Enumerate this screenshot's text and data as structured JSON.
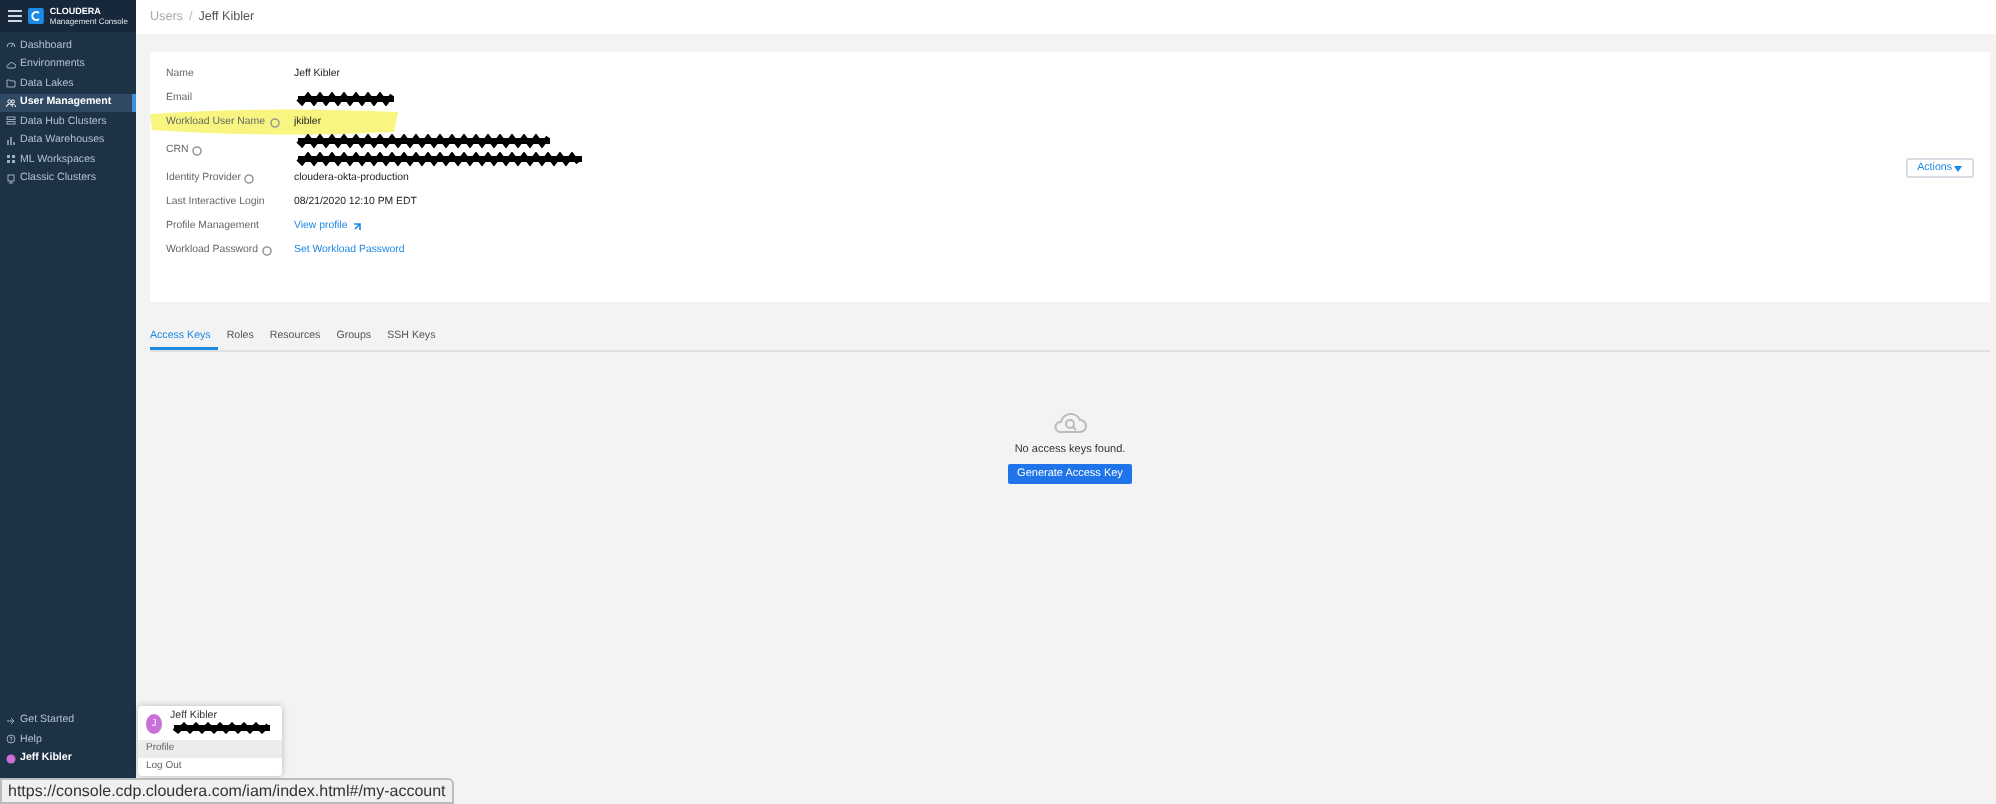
{
  "sidebar": {
    "brand": {
      "name": "CLOUDERA",
      "product": "Management Console"
    },
    "items": [
      {
        "label": "Dashboard",
        "selected": false
      },
      {
        "label": "Environments",
        "selected": false
      },
      {
        "label": "Data Lakes",
        "selected": false
      },
      {
        "label": "User Management",
        "selected": true
      },
      {
        "label": "Data Hub Clusters",
        "selected": false
      },
      {
        "label": "Data Warehouses",
        "selected": false
      },
      {
        "label": "ML Workspaces",
        "selected": false
      },
      {
        "label": "Classic Clusters",
        "selected": false
      }
    ],
    "footer": [
      {
        "label": "Get Started"
      },
      {
        "label": "Help"
      },
      {
        "label": "Jeff Kibler"
      }
    ]
  },
  "breadcrumb": [
    {
      "label": "Users",
      "current": false
    },
    {
      "label": "Jeff Kibler",
      "current": true
    }
  ],
  "breadcrumb_separator": "/",
  "details": [
    {
      "label": "Name",
      "info": false,
      "value": "Jeff Kibler",
      "kind": "text",
      "highlighted": false
    },
    {
      "label": "Email",
      "info": false,
      "kind": "redacted",
      "highlighted": false
    },
    {
      "label": "Workload User Name",
      "info": true,
      "value": "jkibler",
      "kind": "text",
      "highlighted": true
    },
    {
      "label": "CRN",
      "info": true,
      "kind": "redacted2",
      "highlighted": false
    },
    {
      "label": "Identity Provider",
      "info": true,
      "value": "cloudera-okta-production",
      "kind": "text",
      "highlighted": false
    },
    {
      "label": "Last Interactive Login",
      "info": false,
      "value": "08/21/2020 12:10 PM EDT",
      "kind": "text",
      "highlighted": false
    },
    {
      "label": "Profile Management",
      "info": false,
      "value": "View profile",
      "kind": "external-link",
      "highlighted": false
    },
    {
      "label": "Workload Password",
      "info": true,
      "value": "Set Workload Password",
      "kind": "link",
      "highlighted": false
    }
  ],
  "actions_button": "Actions",
  "tabs": [
    {
      "label": "Access Keys",
      "selected": true
    },
    {
      "label": "Roles",
      "selected": false
    },
    {
      "label": "Resources",
      "selected": false
    },
    {
      "label": "Groups",
      "selected": false
    },
    {
      "label": "SSH Keys",
      "selected": false
    }
  ],
  "empty_state": {
    "message": "No access keys found.",
    "button": "Generate Access Key"
  },
  "user_menu": {
    "avatar": "J",
    "name": "Jeff Kibler",
    "items": [
      {
        "label": "Profile",
        "selected": true
      },
      {
        "label": "Log Out",
        "selected": false
      }
    ]
  },
  "status_url": "https://console.cdp.cloudera.com/iam/index.html#/my-account"
}
